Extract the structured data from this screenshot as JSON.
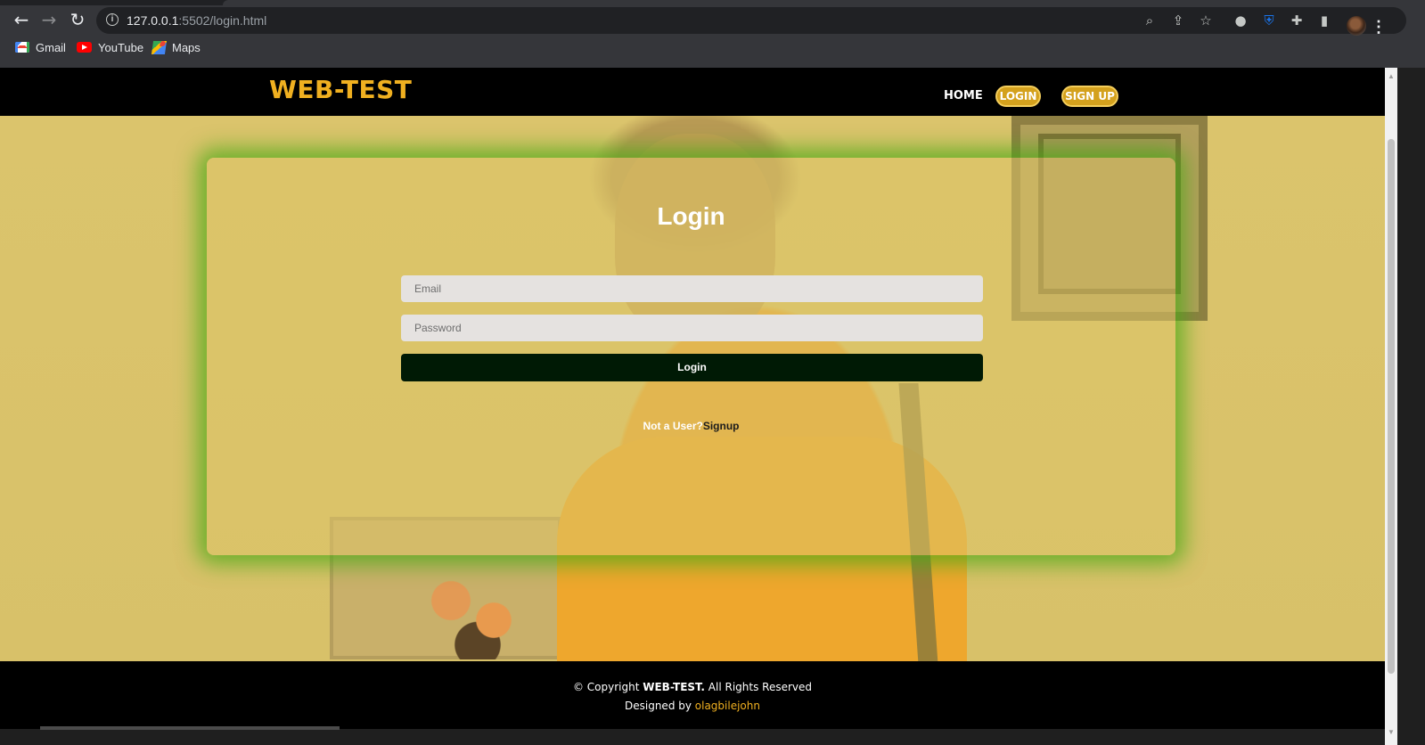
{
  "browser": {
    "url_host": "127.0.0.1",
    "url_rest": ":5502/login.html",
    "bookmarks": [
      {
        "label": "Gmail",
        "icon": "gmail-icon"
      },
      {
        "label": "YouTube",
        "icon": "youtube-icon"
      },
      {
        "label": "Maps",
        "icon": "maps-icon"
      }
    ]
  },
  "header": {
    "brand": "WEB-TEST",
    "nav_home": "HOME",
    "nav_login": "LOGIN",
    "nav_signup": "SIGN UP"
  },
  "login": {
    "title": "Login",
    "email_placeholder": "Email",
    "password_placeholder": "Password",
    "submit_label": "Login",
    "prompt": "Not a User?",
    "signup_link": "Signup"
  },
  "footer": {
    "copyright_prefix": "© Copyright ",
    "copyright_brand": "WEB-TEST.",
    "copyright_suffix": " All Rights Reserved",
    "designed_by": "Designed by ",
    "designer": "olagbilejohn"
  },
  "colors": {
    "brand": "#f0b020",
    "card_glow": "#46aa14",
    "button_dark": "#001a05",
    "pill": "#d4a11d"
  }
}
